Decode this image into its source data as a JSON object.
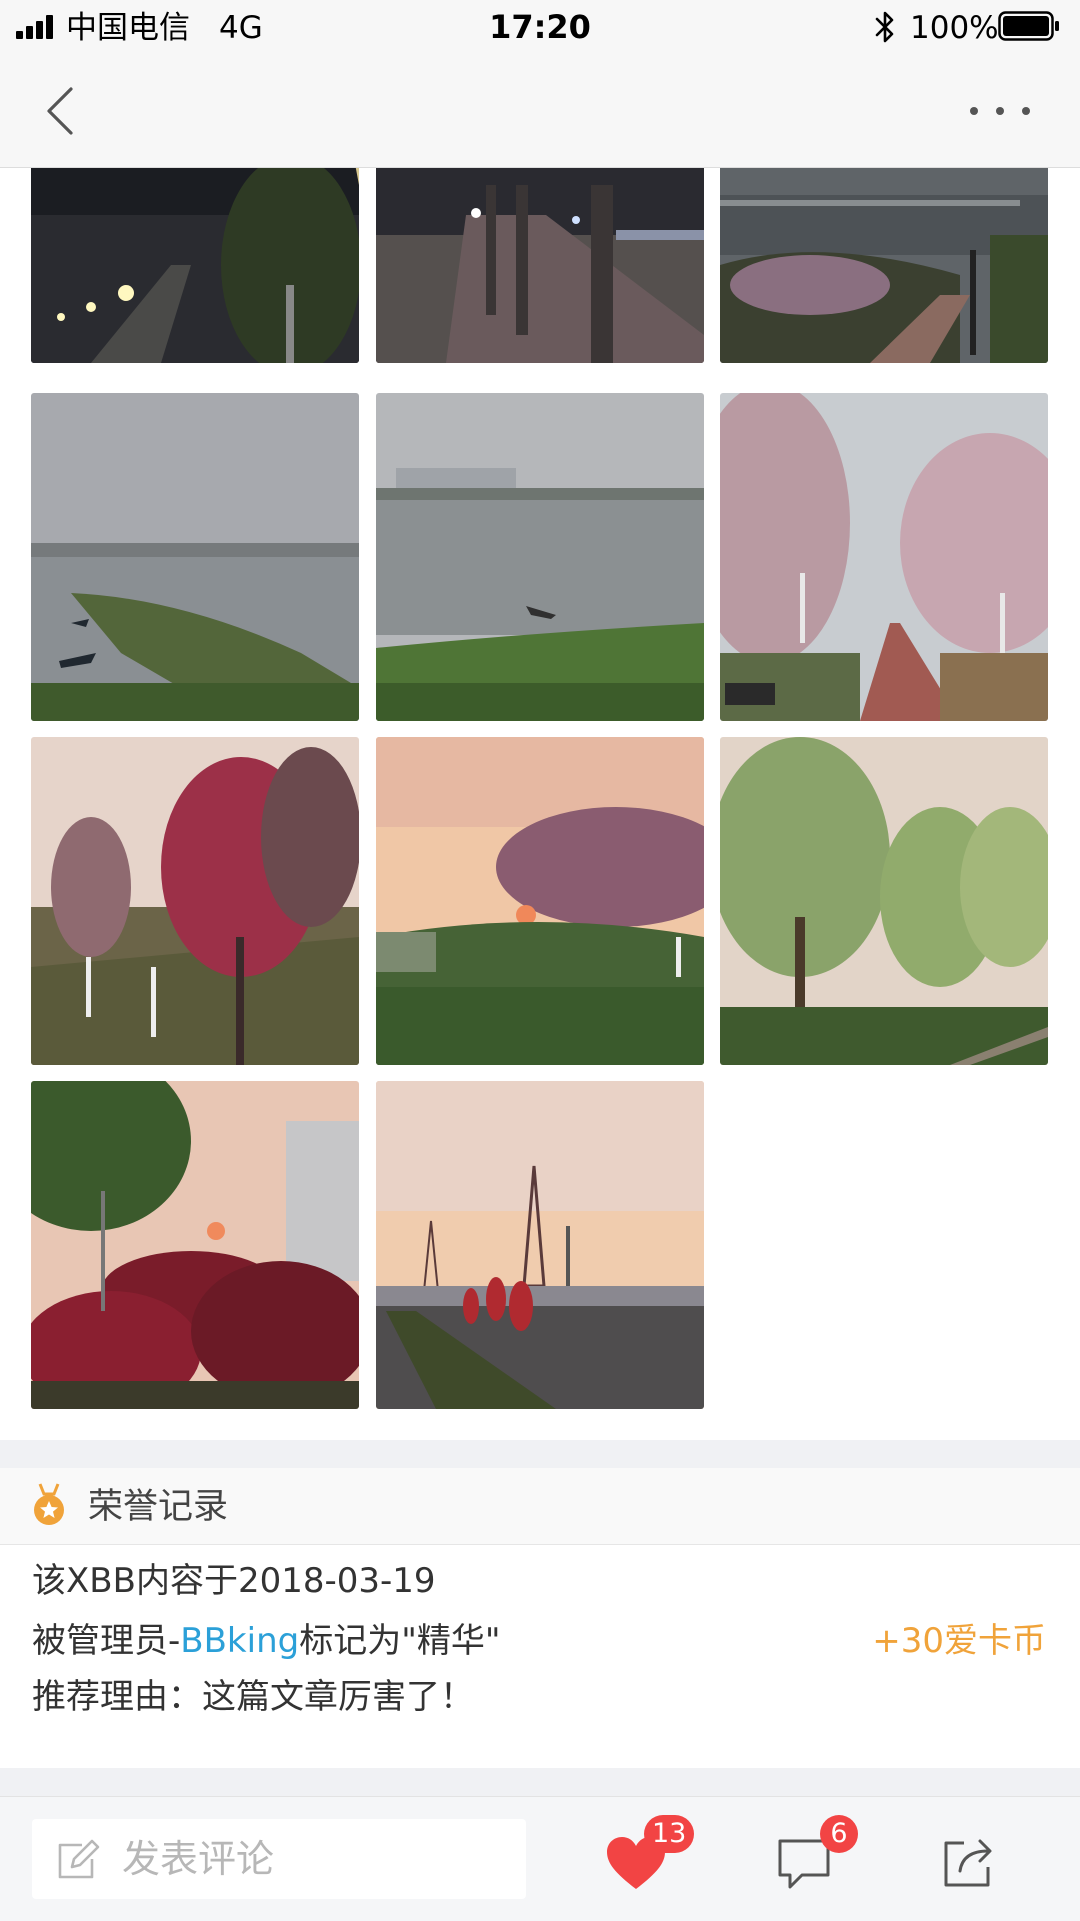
{
  "status_bar": {
    "carrier": "中国电信",
    "network": "4G",
    "time": "17:20",
    "battery_percent": "100%",
    "icons": [
      "signal-bars",
      "bluetooth-icon",
      "battery-icon"
    ]
  },
  "nav": {
    "icons": [
      "back-chevron-icon",
      "more-dots-icon"
    ]
  },
  "photos": [
    {
      "scene": "night riverside walkway with street lamps"
    },
    {
      "scene": "wet pavement under covered walkway at night"
    },
    {
      "scene": "foggy bridge over river with blossoming trees"
    },
    {
      "scene": "misty river with grassy islet and small boats"
    },
    {
      "scene": "hazy river with distant city skyline and boat"
    },
    {
      "scene": "cherry blossom trees along red brick path"
    },
    {
      "scene": "red flowering trees on lawn at dusk"
    },
    {
      "scene": "pink blossom trees on slope at sunset"
    },
    {
      "scene": "weeping willows at dusk"
    },
    {
      "scene": "red shrubs and sunset through trees"
    },
    {
      "scene": "sunset road with pylon and red signboards"
    }
  ],
  "honor": {
    "title": "荣誉记录",
    "line1": "该XBB内容于2018-03-19",
    "line2_prefix": "被管理员-",
    "line2_admin": "BBking",
    "line2_suffix": "标记为\"精华\"",
    "reward": "+30爱卡币",
    "line3": "推荐理由：这篇文章厉害了！",
    "icon": "medal-icon"
  },
  "toolbar": {
    "comment_placeholder": "发表评论",
    "like_count": "13",
    "comment_count": "6",
    "icons": [
      "edit-icon",
      "heart-icon",
      "chat-bubble-icon",
      "share-icon"
    ]
  },
  "colors": {
    "link_blue": "#2ba0d8",
    "reward_orange": "#f0a33a",
    "badge_red": "#f24444",
    "heart_red": "#f24444"
  }
}
